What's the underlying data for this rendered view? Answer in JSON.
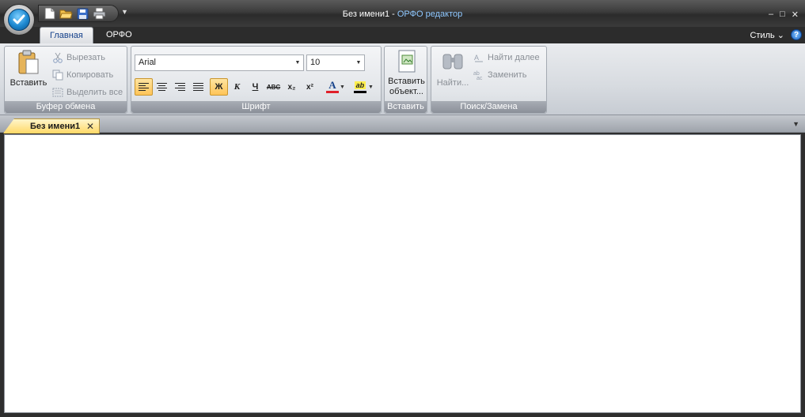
{
  "window": {
    "doc_title": "Без имени1",
    "separator": " - ",
    "app_name": "ОРФО редактор",
    "controls": [
      "–",
      "□",
      "✕"
    ]
  },
  "tabs": [
    {
      "label": "Главная",
      "active": true
    },
    {
      "label": "ОРФО",
      "active": false
    }
  ],
  "style_menu": "Стиль ⌄",
  "help_label": "?",
  "clipboard": {
    "title": "Буфер обмена",
    "paste": "Вставить",
    "cut": "Вырезать",
    "copy": "Копировать",
    "select_all": "Выделить все"
  },
  "font": {
    "title": "Шрифт",
    "family": "Arial",
    "size": "10",
    "buttons": [
      "Ж",
      "К",
      "Ч",
      "ABC",
      "x₂",
      "x²",
      "A",
      "ab"
    ]
  },
  "insert": {
    "title": "Вставить",
    "object_line1": "Вставить",
    "object_line2": "объект..."
  },
  "find": {
    "title": "Поиск/Замена",
    "find": "Найти...",
    "find_next": "Найти далее",
    "replace": "Заменить"
  },
  "document": {
    "tab_label": "Без имени1",
    "close": "✕"
  },
  "colors": {
    "accent_blue": "#15428b",
    "font_color_bar": "#e0202a",
    "highlight_color_bar": "#000000",
    "active_button": "#ffc458"
  }
}
